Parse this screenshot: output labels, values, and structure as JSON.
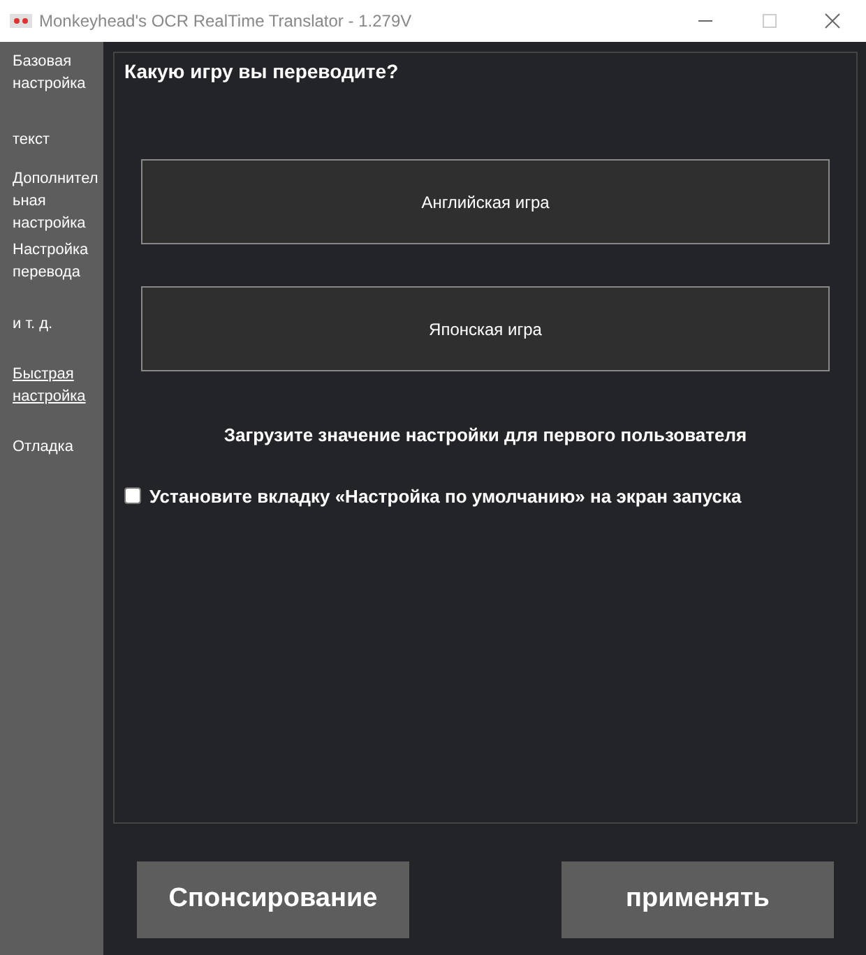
{
  "window": {
    "title": "Monkeyhead's OCR RealTime Translator - 1.279V"
  },
  "sidebar": {
    "items": [
      {
        "label": "Базовая настройка",
        "selected": false
      },
      {
        "label": "текст",
        "selected": false
      },
      {
        "label": "Дополнительная настройка",
        "selected": false
      },
      {
        "label": "Настройка перевода",
        "selected": false
      },
      {
        "label": "и т. д.",
        "selected": false
      },
      {
        "label": "Быстрая настройка",
        "selected": true
      },
      {
        "label": "Отладка",
        "selected": false
      }
    ]
  },
  "panel": {
    "heading": "Какую игру вы переводите?",
    "game_buttons": [
      "Английская игра",
      "Японская игра"
    ],
    "note": "Загрузите значение настройки для первого пользователя",
    "checkbox": {
      "label": "Установите вкладку «Настройка по умолчанию» на экран запуска",
      "checked": false
    }
  },
  "footer": {
    "buttons": [
      "Спонсирование",
      "применять"
    ]
  }
}
